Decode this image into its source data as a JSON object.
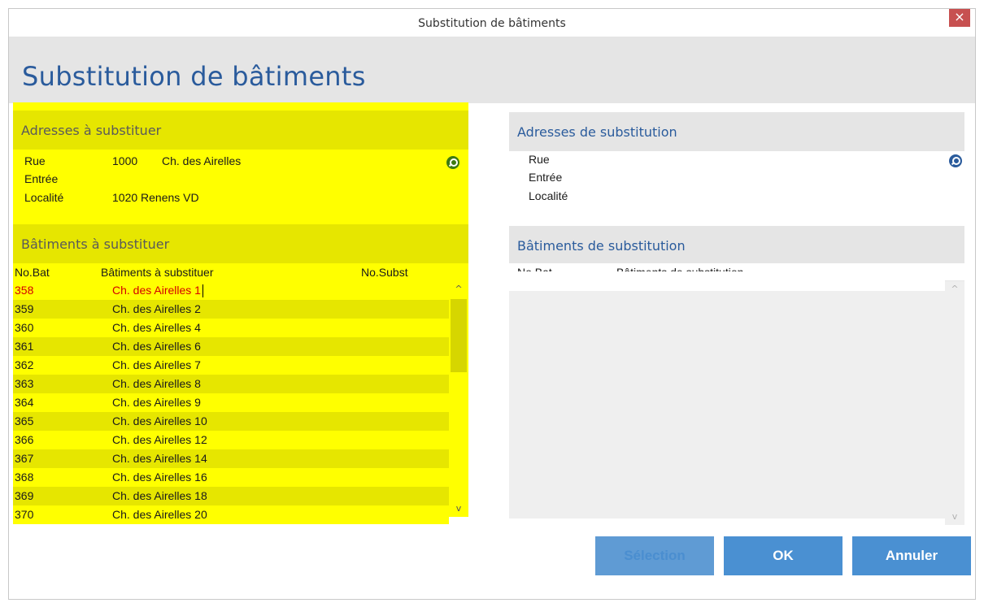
{
  "window": {
    "title": "Substitution de bâtiments",
    "close_glyph": "×",
    "heading": "Substitution de bâtiments"
  },
  "left": {
    "address_section_title": "Adresses à substituer",
    "address": {
      "street_label": "Rue",
      "street_number": "1000",
      "street_name": "Ch. des Airelles",
      "entry_label": "Entrée",
      "locality_label": "Localité",
      "locality_value": "1020 Renens VD"
    },
    "buildings_section_title": "Bâtiments à substituer",
    "columns": [
      "No.Bat",
      "Bâtiments à substituer",
      "No.Subst"
    ],
    "rows": [
      {
        "no": "358",
        "name": "Ch. des Airelles 1",
        "subst": ""
      },
      {
        "no": "359",
        "name": "Ch. des Airelles 2",
        "subst": ""
      },
      {
        "no": "360",
        "name": "Ch. des Airelles 4",
        "subst": ""
      },
      {
        "no": "361",
        "name": "Ch. des Airelles 6",
        "subst": ""
      },
      {
        "no": "362",
        "name": "Ch. des Airelles 7",
        "subst": ""
      },
      {
        "no": "363",
        "name": "Ch. des Airelles 8",
        "subst": ""
      },
      {
        "no": "364",
        "name": "Ch. des Airelles 9",
        "subst": ""
      },
      {
        "no": "365",
        "name": "Ch. des Airelles 10",
        "subst": ""
      },
      {
        "no": "366",
        "name": "Ch. des Airelles 12",
        "subst": ""
      },
      {
        "no": "367",
        "name": "Ch. des Airelles 14",
        "subst": ""
      },
      {
        "no": "368",
        "name": "Ch. des Airelles 16",
        "subst": ""
      },
      {
        "no": "369",
        "name": "Ch. des Airelles 18",
        "subst": ""
      },
      {
        "no": "370",
        "name": "Ch. des Airelles 20",
        "subst": ""
      }
    ],
    "selected_row": 0
  },
  "right": {
    "address_section_title": "Adresses de substitution",
    "address": {
      "street_label": "Rue",
      "entry_label": "Entrée",
      "locality_label": "Localité"
    },
    "buildings_section_title": "Bâtiments de substitution",
    "columns": [
      "No.Bat",
      "Bâtiments de substitution"
    ]
  },
  "buttons": {
    "selection": "Sélection",
    "ok": "OK",
    "cancel": "Annuler"
  },
  "icons": {
    "left_search": "search-icon",
    "right_search": "search-icon",
    "scroll_up": "chevron-up-icon",
    "scroll_down": "chevron-down-icon"
  },
  "colors": {
    "highlight": "#ffff00",
    "accent": "#2a5b9c",
    "button": "#4a90d2",
    "selected_text": "#d40000"
  }
}
